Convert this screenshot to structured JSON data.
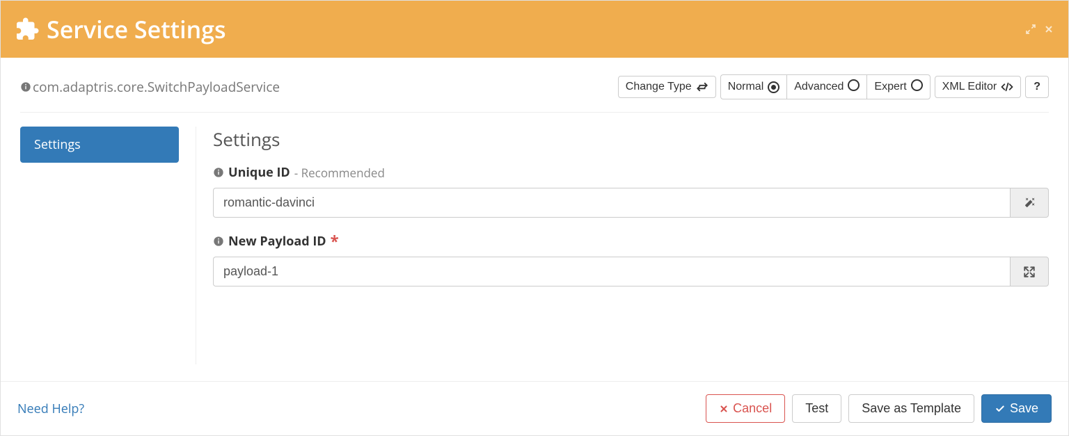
{
  "header": {
    "title": "Service Settings",
    "classname": "com.adaptris.core.SwitchPayloadService"
  },
  "toolbar": {
    "change_type": "Change Type",
    "normal": "Normal",
    "advanced": "Advanced",
    "expert": "Expert",
    "xml_editor": "XML Editor",
    "help": "?"
  },
  "sidebar": {
    "items": [
      {
        "label": "Settings"
      }
    ]
  },
  "form": {
    "section_title": "Settings",
    "unique_id": {
      "label": "Unique ID",
      "hint": "- Recommended",
      "value": "romantic-davinci"
    },
    "new_payload_id": {
      "label": "New Payload ID",
      "value": "payload-1"
    }
  },
  "footer": {
    "help_link": "Need Help?",
    "cancel": "Cancel",
    "test": "Test",
    "save_template": "Save as Template",
    "save": "Save"
  }
}
